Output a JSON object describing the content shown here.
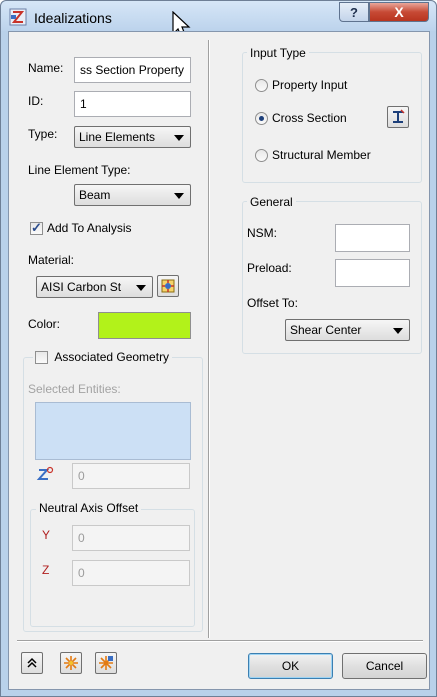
{
  "window": {
    "title": "Idealizations",
    "help_label": "?",
    "close_label": "X"
  },
  "left": {
    "name_label": "Name:",
    "name_value": "ss Section Property",
    "id_label": "ID:",
    "id_value": "1",
    "type_label": "Type:",
    "type_value": "Line Elements",
    "line_element_type_label": "Line Element Type:",
    "line_element_type_value": "Beam",
    "add_to_analysis_label": "Add To Analysis",
    "add_to_analysis_checked": true,
    "material_label": "Material:",
    "material_value": "AISI Carbon St",
    "color_label": "Color:",
    "color_value": "#b2f21a",
    "associated_geometry_label": "Associated Geometry",
    "associated_geometry_checked": false,
    "selected_entities_label": "Selected Entities:",
    "entity_count_value": "0",
    "neutral_axis_offset_label": "Neutral Axis Offset",
    "y_label": "Y",
    "y_value": "0",
    "z_label": "Z",
    "z_value": "0"
  },
  "right": {
    "input_type_label": "Input Type",
    "options": [
      {
        "label": "Property Input",
        "selected": false
      },
      {
        "label": "Cross Section",
        "selected": true
      },
      {
        "label": "Structural Member",
        "selected": false
      }
    ],
    "general_label": "General",
    "nsm_label": "NSM:",
    "nsm_value": "",
    "preload_label": "Preload:",
    "preload_value": "",
    "offset_to_label": "Offset To:",
    "offset_to_value": "Shear Center"
  },
  "footer": {
    "ok_label": "OK",
    "cancel_label": "Cancel"
  },
  "icons": [
    "idealizations-app-icon",
    "mouse-cursor-icon",
    "cross-section-editor-icon",
    "material-library-icon",
    "entity-select-icon",
    "collapse-icon",
    "snowflake-icon",
    "snowflake-multi-icon"
  ]
}
